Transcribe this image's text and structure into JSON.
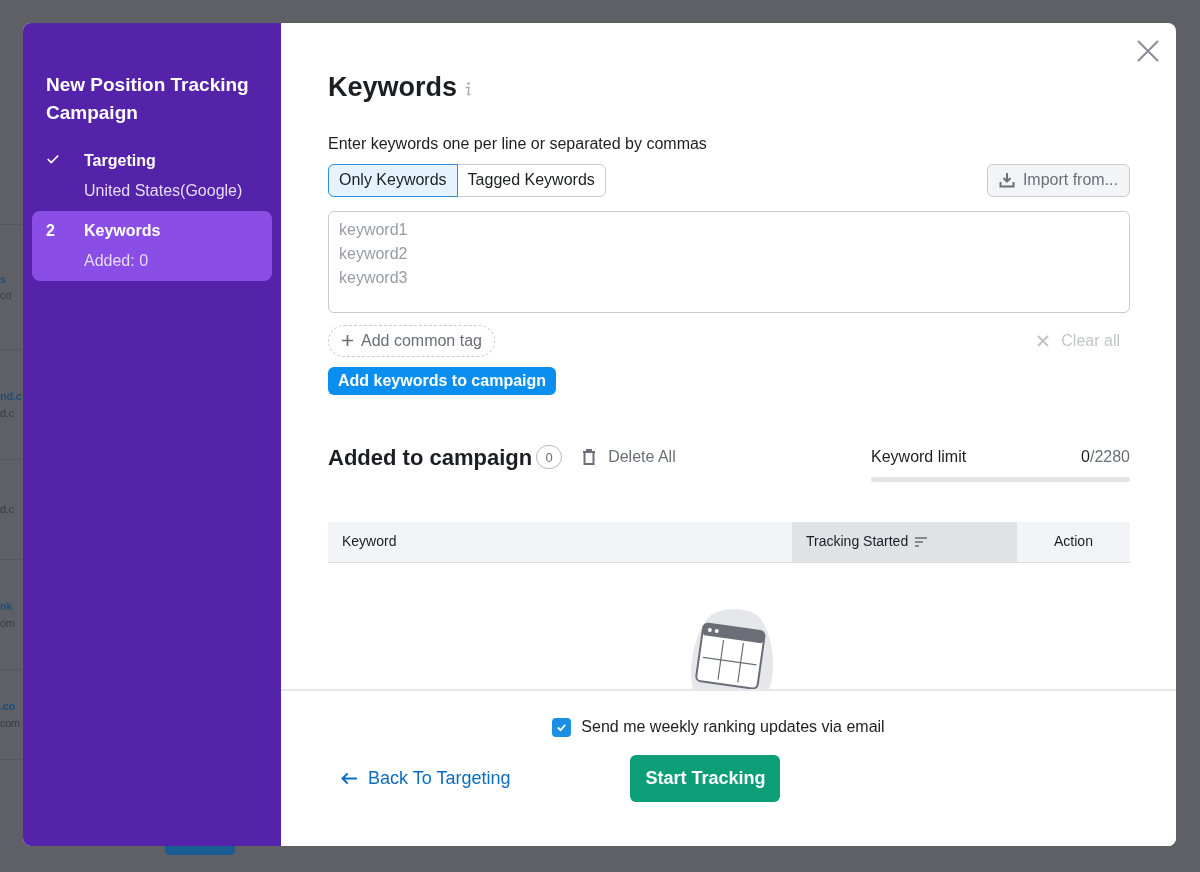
{
  "background": {
    "rows": [
      {
        "title": "s",
        "subtitle": "co"
      },
      {
        "title": "nd.c",
        "subtitle": "d.c"
      },
      {
        "title": "",
        "subtitle": "d.c"
      },
      {
        "title": "nk",
        "subtitle": "om"
      },
      {
        "title": ".co",
        "subtitle": "com"
      }
    ]
  },
  "sidebar": {
    "title": "New Position Tracking Campaign",
    "steps": [
      {
        "kind": "done",
        "label": "Targeting",
        "detail": "United States(Google)",
        "selected": false
      },
      {
        "kind": "current",
        "number": "2",
        "label": "Keywords",
        "detail": "Added: 0",
        "selected": true
      }
    ]
  },
  "main": {
    "title": "Keywords",
    "instructions": "Enter keywords one per line or separated by commas",
    "tabs": [
      {
        "label": "Only Keywords",
        "selected": true
      },
      {
        "label": "Tagged Keywords",
        "selected": false
      }
    ],
    "import_button": "Import from...",
    "keywords_field": {
      "placeholder": "keyword1\nkeyword2\nkeyword3"
    },
    "add_tag_button": "Add common tag",
    "clear_all_button": {
      "label": "Clear all",
      "disabled": true
    },
    "add_button": "Add keywords to campaign",
    "added": {
      "title": "Added to campaign",
      "count": "0",
      "delete_button": "Delete All"
    },
    "keyword_limit": {
      "label": "Keyword limit",
      "used": "0",
      "total": "/2280",
      "level": 0
    },
    "table": {
      "columns": [
        {
          "label": "Keyword",
          "sorted": false
        },
        {
          "label": "Tracking Started",
          "sorted": true
        },
        {
          "label": "Action",
          "sorted": false
        }
      ]
    }
  },
  "footer": {
    "email_updates": {
      "label": "Send me weekly ranking updates via email",
      "checked": true
    },
    "back_button": "Back To Targeting",
    "start_button": "Start Tracking"
  }
}
